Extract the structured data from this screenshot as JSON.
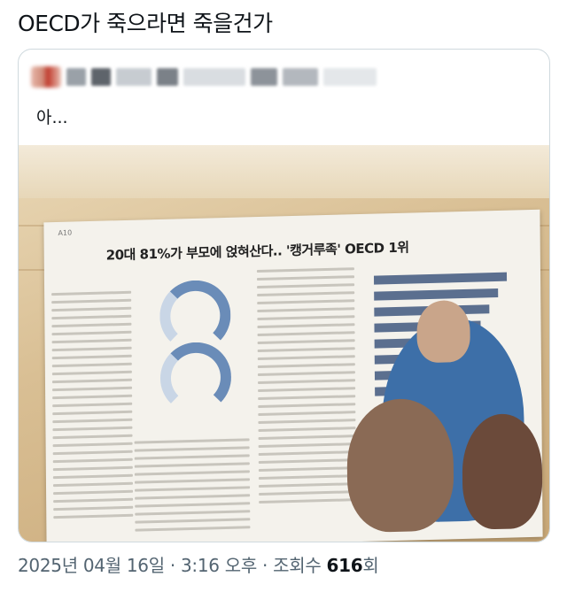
{
  "post": {
    "text": "OECD가 죽으라면 죽을건가"
  },
  "quote": {
    "body": "아...",
    "photo": {
      "section_tag": "A10",
      "headline": "20대 81%가 부모에 얹혀산다.. '캥거루족' OECD 1위"
    }
  },
  "meta": {
    "date": "2025년 04월 16일",
    "separator1": "·",
    "time": "3:16 오후",
    "separator2": "·",
    "views_label": "조회수",
    "views_count": "616",
    "views_unit": "회"
  },
  "colors": {
    "text_primary": "#0f1419",
    "text_secondary": "#536471",
    "border": "#cfd9de"
  }
}
